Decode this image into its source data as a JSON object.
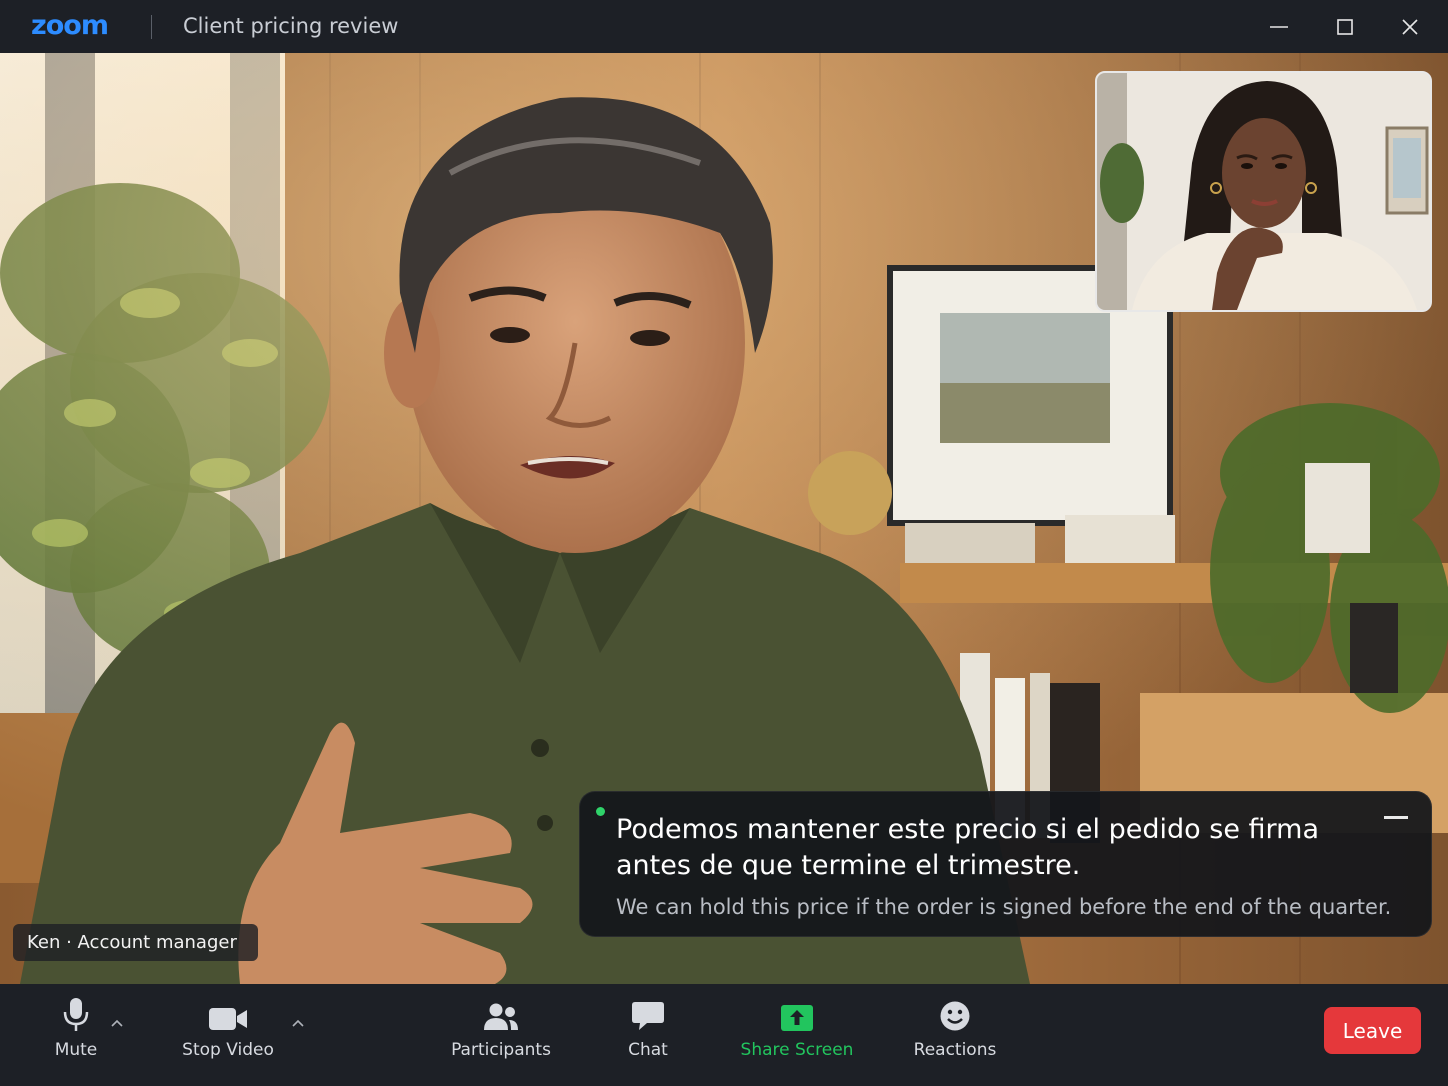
{
  "app": {
    "logo": "zoom",
    "meeting_title": "Client pricing review"
  },
  "window_controls": {
    "minimize_icon": "minimize-icon",
    "maximize_icon": "maximize-icon",
    "close_icon": "close-icon"
  },
  "speaker": {
    "name_tag": "Ken · Account manager"
  },
  "caption": {
    "original": "Podemos mantener este precio si el pedido se firma antes de que termine el trimestre.",
    "translation": "We can hold this price if the order is signed before the end of the quarter.",
    "live_indicator_color": "#2fd36a"
  },
  "toolbar": {
    "mute": "Mute",
    "stop_video": "Stop Video",
    "participants": "Participants",
    "chat": "Chat",
    "share_screen": "Share Screen",
    "reactions": "Reactions",
    "leave": "Leave"
  },
  "colors": {
    "brand": "#2d8cff",
    "share": "#22c55e",
    "leave": "#e5383b",
    "toolbar_bg": "#1d2026"
  }
}
